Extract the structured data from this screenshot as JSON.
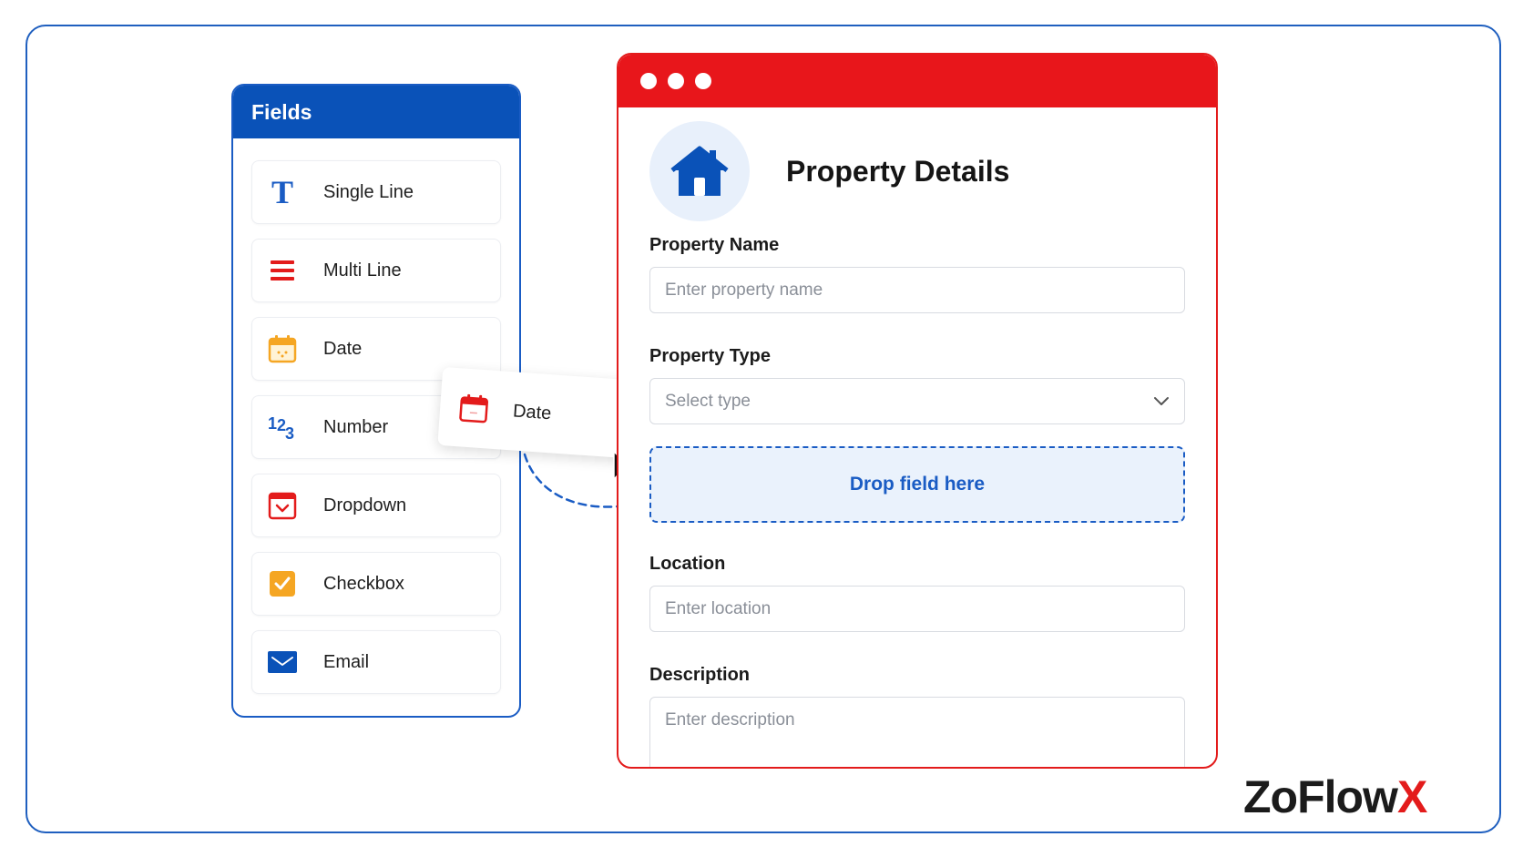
{
  "fields_panel": {
    "title": "Fields",
    "items": [
      {
        "label": "Single Line",
        "icon": "text-t-icon"
      },
      {
        "label": "Multi Line",
        "icon": "lines-icon"
      },
      {
        "label": "Date",
        "icon": "calendar-icon"
      },
      {
        "label": "Number",
        "icon": "number-123-icon"
      },
      {
        "label": "Dropdown",
        "icon": "dropdown-icon"
      },
      {
        "label": "Checkbox",
        "icon": "checkbox-icon"
      },
      {
        "label": "Email",
        "icon": "envelope-icon"
      }
    ]
  },
  "drag_card": {
    "label": "Date",
    "icon": "calendar-icon"
  },
  "form": {
    "title": "Property Details",
    "property_name": {
      "label": "Property Name",
      "placeholder": "Enter property name"
    },
    "property_type": {
      "label": "Property Type",
      "value": "Select type"
    },
    "drop_zone": "Drop field here",
    "location": {
      "label": "Location",
      "placeholder": "Enter location"
    },
    "description": {
      "label": "Description",
      "placeholder": "Enter description"
    }
  },
  "brand": {
    "name_main": "ZoFlow",
    "name_accent": "X"
  },
  "colors": {
    "blue": "#0a52b8",
    "red": "#e8161b",
    "orange": "#f5a623"
  }
}
